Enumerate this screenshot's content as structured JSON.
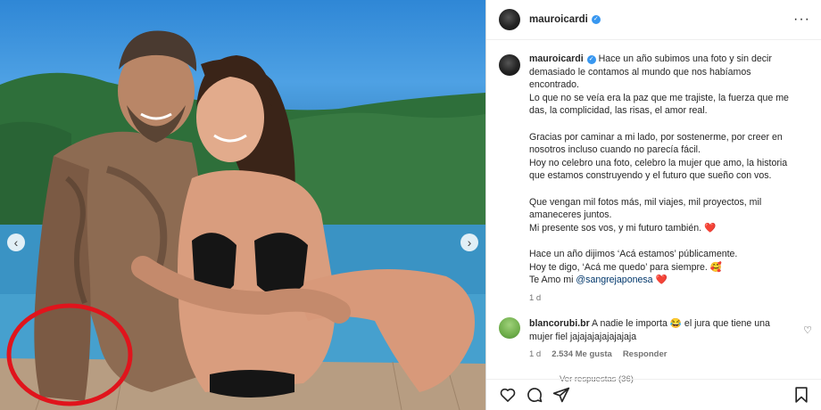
{
  "post": {
    "username": "mauroicardi",
    "verified": true,
    "caption": [
      "Hace un año subimos una foto y sin decir demasiado le contamos al mundo que nos habíamos encontrado.",
      "Lo que no se veía era la paz que me trajiste, la fuerza que me das, la complicidad, las risas, el amor real.",
      "",
      "Gracias por caminar a mi lado, por sostenerme, por creer en nosotros incluso cuando no parecía fácil.",
      "Hoy no celebro una foto, celebro la mujer que amo, la historia que estamos construyendo y el futuro que sueño con vos.",
      "",
      "Que vengan mil fotos más, mil viajes, mil proyectos, mil amaneceres juntos.",
      "Mi presente sos vos, y mi futuro también. ❤️",
      "",
      "Hace un año dijimos ‘Acá estamos’ públicamente.",
      "Hoy te digo, ‘Acá me quedo’ para siempre. 🥰"
    ],
    "last_line_prefix": "Te Amo mi ",
    "last_line_mention": "@sangrejaponesa",
    "last_line_suffix": " ❤️",
    "time": "1 d"
  },
  "comment": {
    "username": "blancorubi.br",
    "text": "A nadie le importa 😂 el jura que tiene una mujer fiel jajajajajajajajaja",
    "time": "1 d",
    "likes": "2.534 Me gusta",
    "reply_label": "Responder",
    "view_replies": "Ver respuestas (36)"
  },
  "icons": {
    "more": "more-options-icon",
    "like": "heart-icon",
    "comment": "comment-icon",
    "share": "share-icon",
    "save": "bookmark-icon"
  },
  "colors": {
    "verified": "#3897f0",
    "mention": "#00376b",
    "circle_annotation": "#e0141c"
  }
}
